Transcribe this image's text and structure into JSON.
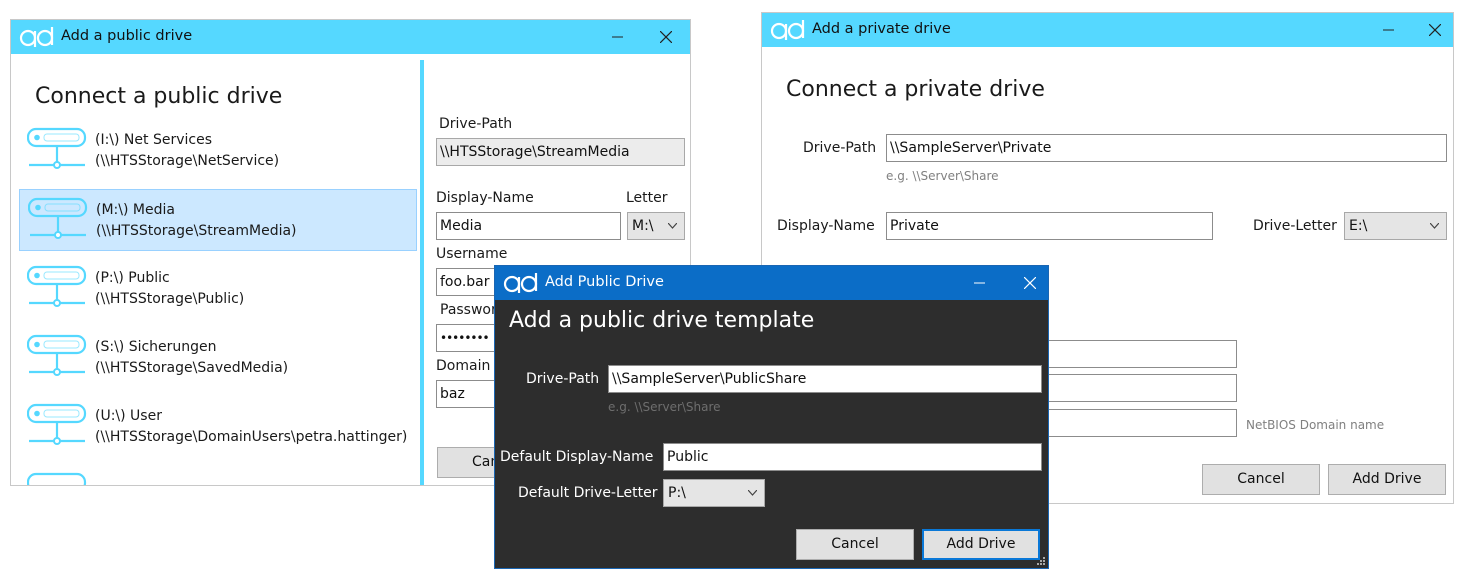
{
  "public_window": {
    "title": "Add a public drive",
    "heading": "Connect a public drive",
    "drives": [
      {
        "line1": "(I:\\) Net Services",
        "line2": "(\\\\HTSStorage\\NetService)",
        "selected": false
      },
      {
        "line1": "(M:\\) Media",
        "line2": "(\\\\HTSStorage\\StreamMedia)",
        "selected": true
      },
      {
        "line1": "(P:\\) Public",
        "line2": "(\\\\HTSStorage\\Public)",
        "selected": false
      },
      {
        "line1": "(S:\\) Sicherungen",
        "line2": "(\\\\HTSStorage\\SavedMedia)",
        "selected": false
      },
      {
        "line1": "(U:\\) User",
        "line2": "(\\\\HTSStorage\\DomainUsers\\petra.hattinger)",
        "selected": false
      }
    ],
    "drive_path_label": "Drive-Path",
    "drive_path_value": "\\\\HTSStorage\\StreamMedia",
    "display_name_label": "Display-Name",
    "display_name_value": "Media",
    "letter_label": "Letter",
    "letter_value": "M:\\",
    "username_label": "Username",
    "username_value": "foo.bar",
    "password_label": "Passwor",
    "password_value": "••••••••",
    "domain_label": "Domain",
    "domain_value": "baz",
    "cancel_label": "Can"
  },
  "private_window": {
    "title": "Add a private drive",
    "heading": "Connect a private drive",
    "drive_path_label": "Drive-Path",
    "drive_path_value": "\\\\SampleServer\\Private",
    "drive_path_hint": "e.g. \\\\Server\\Share",
    "display_name_label": "Display-Name",
    "display_name_value": "Private",
    "drive_letter_label": "Drive-Letter",
    "drive_letter_value": "E:\\",
    "domain_hint": "NetBIOS Domain name",
    "cancel_label": "Cancel",
    "add_label": "Add Drive"
  },
  "template_dialog": {
    "title": "Add Public Drive",
    "heading": "Add a public drive template",
    "drive_path_label": "Drive-Path",
    "drive_path_value": "\\\\SampleServer\\PublicShare",
    "drive_path_hint": "e.g. \\\\Server\\Share",
    "display_name_label": "Default Display-Name",
    "display_name_value": "Public",
    "drive_letter_label": "Default Drive-Letter",
    "drive_letter_value": "P:\\",
    "cancel_label": "Cancel",
    "add_label": "Add Drive"
  },
  "colors": {
    "title_bar_light": "#55d8ff",
    "title_bar_dark": "#0b6dc7",
    "dialog_background": "#2d2d2d",
    "selection": "#cce8ff",
    "drive_icon": "#55d8ff",
    "splitter": "#55d8ff"
  },
  "icons": {
    "app_logo": "qd-logo-icon",
    "minimize": "minimize-icon",
    "close": "close-icon",
    "drive": "network-drive-icon",
    "dropdown": "chevron-down-icon"
  }
}
